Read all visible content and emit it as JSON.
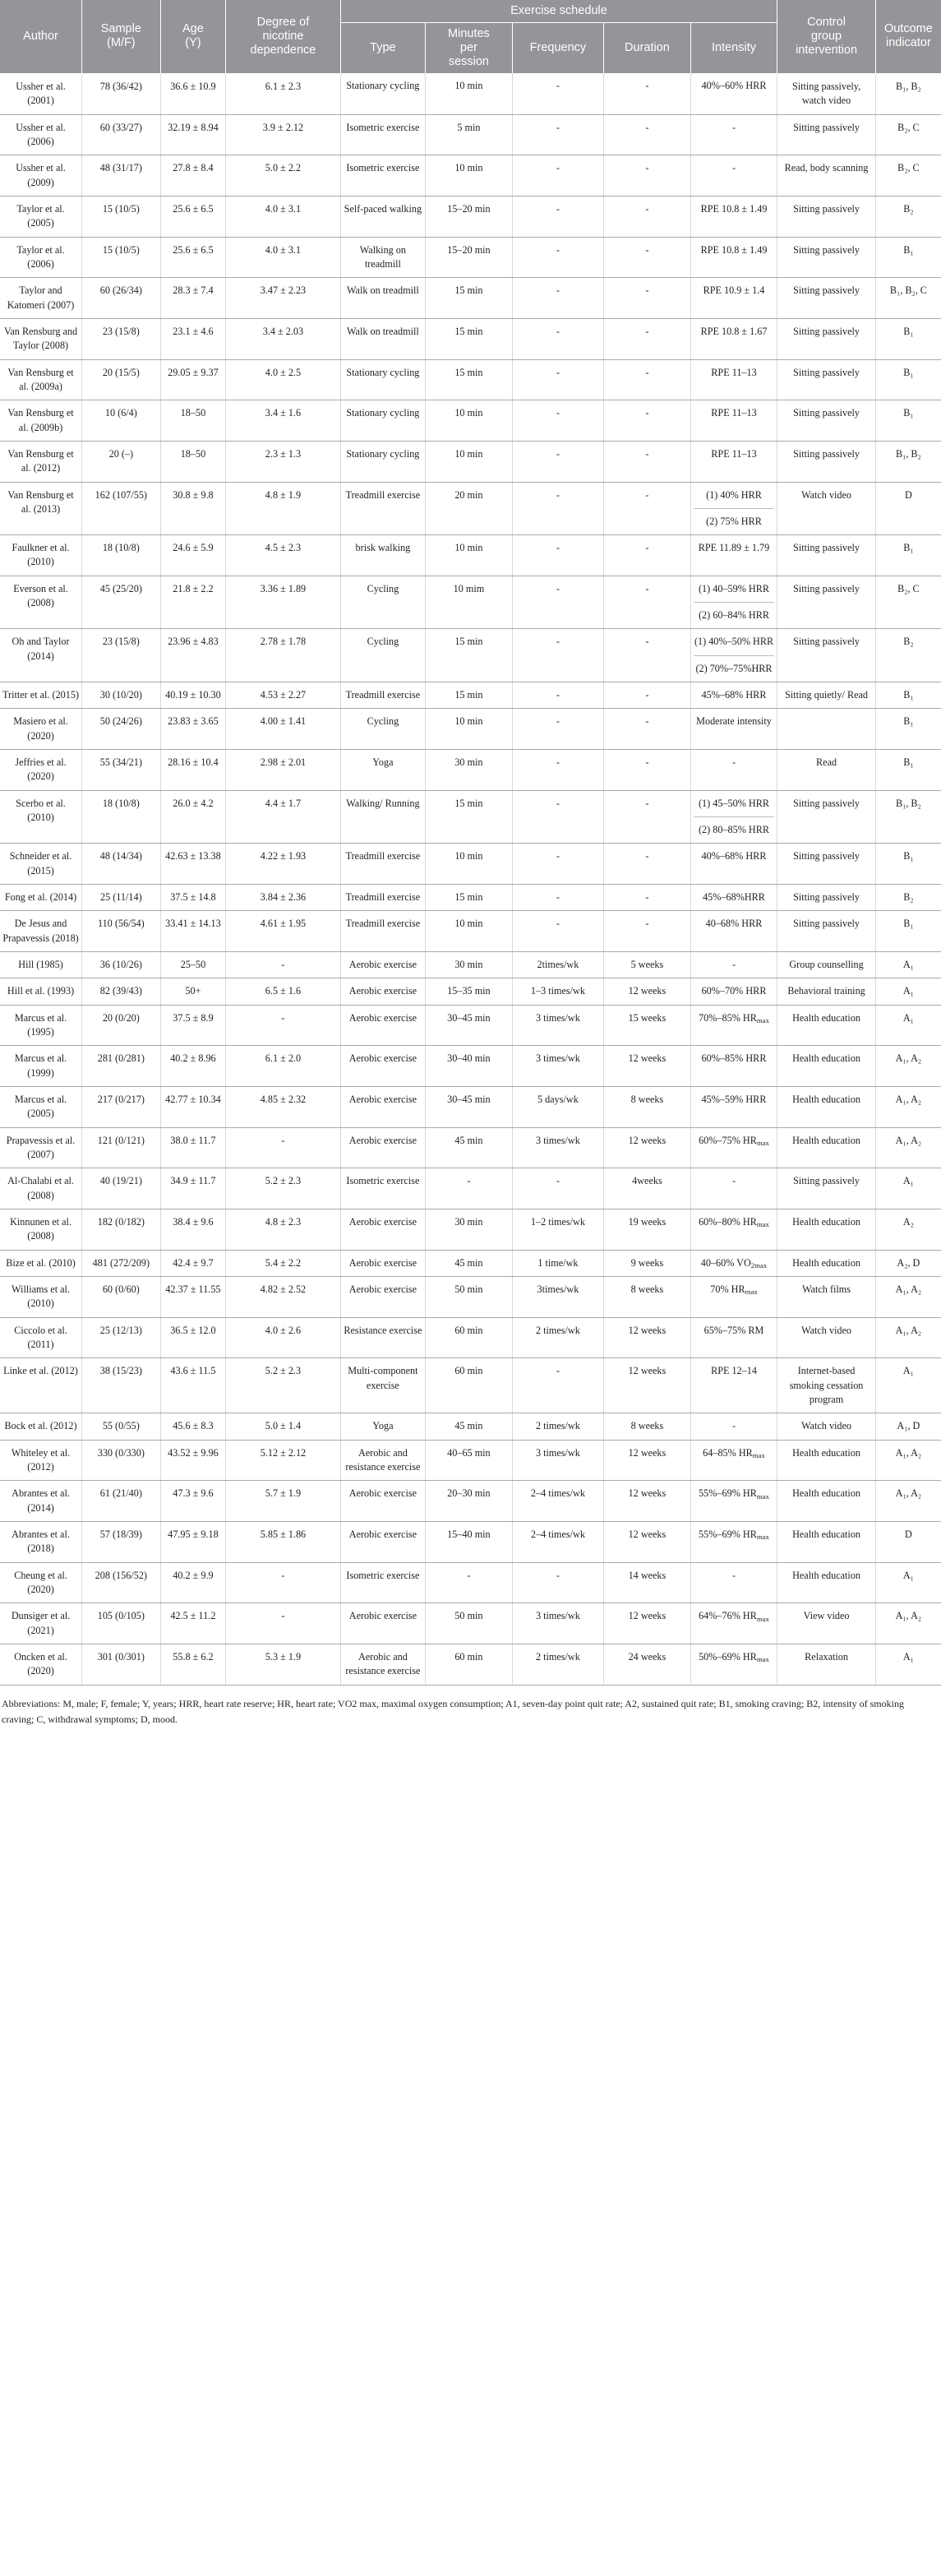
{
  "table": {
    "header": {
      "group_exercise_schedule": "Exercise schedule",
      "columns": [
        "Author",
        "Sample (M/F)",
        "Age (Y)",
        "Degree of nicotine dependence",
        "Type",
        "Minutes per session",
        "Frequency",
        "Duration",
        "Intensity",
        "Control group intervention",
        "Outcome indicator"
      ],
      "author": "Author",
      "sample": "Sample\n(M/F)",
      "sample_l1": "Sample",
      "sample_l2": "(M/F)",
      "age_l1": "Age",
      "age_l2": "(Y)",
      "nicotine_l1": "Degree of",
      "nicotine_l2": "nicotine",
      "nicotine_l3": "dependence",
      "type": "Type",
      "minutes_l1": "Minutes",
      "minutes_l2": "per",
      "minutes_l3": "session",
      "frequency": "Frequency",
      "duration": "Duration",
      "intensity": "Intensity",
      "control_l1": "Control",
      "control_l2": "group",
      "control_l3": "intervention",
      "outcome_l1": "Outcome",
      "outcome_l2": "indicator"
    },
    "rows": [
      {
        "author": "Ussher et al. (2001)",
        "sample": "78 (36/42)",
        "age": "36.6 ± 10.9",
        "nicotine": "6.1 ± 2.3",
        "type": "Stationary cycling",
        "minutes": "10 min",
        "frequency": "-",
        "duration": "-",
        "intensity": "40%–60% HRR",
        "control": "Sitting passively, watch video",
        "outcome": "B₁, B₂"
      },
      {
        "author": "Ussher et al. (2006)",
        "sample": "60 (33/27)",
        "age": "32.19 ± 8.94",
        "nicotine": "3.9 ± 2.12",
        "type": "Isometric exercise",
        "minutes": "5 min",
        "frequency": "-",
        "duration": "-",
        "intensity": "-",
        "control": "Sitting passively",
        "outcome": "B₂, C"
      },
      {
        "author": "Ussher et al. (2009)",
        "sample": "48 (31/17)",
        "age": "27.8 ± 8.4",
        "nicotine": "5.0 ± 2.2",
        "type": "Isometric exercise",
        "minutes": "10 min",
        "frequency": "-",
        "duration": "-",
        "intensity": "-",
        "control": "Read, body scanning",
        "outcome": "B₂, C"
      },
      {
        "author": "Taylor et al. (2005)",
        "sample": "15 (10/5)",
        "age": "25.6 ± 6.5",
        "nicotine": "4.0 ± 3.1",
        "type": "Self-paced walking",
        "minutes": "15–20 min",
        "frequency": "-",
        "duration": "-",
        "intensity": "RPE 10.8 ± 1.49",
        "control": "Sitting passively",
        "outcome": "B₂"
      },
      {
        "author": "Taylor et al. (2006)",
        "sample": "15 (10/5)",
        "age": "25.6 ± 6.5",
        "nicotine": "4.0 ± 3.1",
        "type": "Walking on treadmill",
        "minutes": "15–20 min",
        "frequency": "-",
        "duration": "-",
        "intensity": "RPE 10.8 ± 1.49",
        "control": "Sitting passively",
        "outcome": "B₁"
      },
      {
        "author": "Taylor and Katomeri (2007)",
        "sample": "60 (26/34)",
        "age": "28.3 ± 7.4",
        "nicotine": "3.47 ± 2.23",
        "type": "Walk on treadmill",
        "minutes": "15 min",
        "frequency": "-",
        "duration": "-",
        "intensity": "RPE 10.9 ± 1.4",
        "control": "Sitting passively",
        "outcome": "B₁, B₂, C"
      },
      {
        "author": "Van Rensburg and Taylor (2008)",
        "sample": "23 (15/8)",
        "age": "23.1 ± 4.6",
        "nicotine": "3.4 ± 2.03",
        "type": "Walk on treadmill",
        "minutes": "15 min",
        "frequency": "-",
        "duration": "-",
        "intensity": "RPE 10.8 ± 1.67",
        "control": "Sitting passively",
        "outcome": "B₁"
      },
      {
        "author": "Van Rensburg et al. (2009a)",
        "sample": "20 (15/5)",
        "age": "29.05 ± 9.37",
        "nicotine": "4.0 ± 2.5",
        "type": "Stationary cycling",
        "minutes": "15 min",
        "frequency": "-",
        "duration": "-",
        "intensity": "RPE 11–13",
        "control": "Sitting passively",
        "outcome": "B₁"
      },
      {
        "author": "Van Rensburg et al. (2009b)",
        "sample": "10 (6/4)",
        "age": "18–50",
        "nicotine": "3.4 ± 1.6",
        "type": "Stationary cycling",
        "minutes": "10 min",
        "frequency": "-",
        "duration": "-",
        "intensity": "RPE 11–13",
        "control": "Sitting passively",
        "outcome": "B₁"
      },
      {
        "author": "Van Rensburg et al. (2012)",
        "sample": "20 (–)",
        "age": "18–50",
        "nicotine": "2.3 ± 1.3",
        "type": "Stationary cycling",
        "minutes": "10 min",
        "frequency": "-",
        "duration": "-",
        "intensity": "RPE 11–13",
        "control": "Sitting passively",
        "outcome": "B₁, B₂"
      },
      {
        "author": "Van Rensburg et al. (2013)",
        "sample": "162 (107/55)",
        "age": "30.8 ± 9.8",
        "nicotine": "4.8 ± 1.9",
        "type": "Treadmill exercise",
        "minutes": "20 min",
        "frequency": "-",
        "duration": "-",
        "intensity_parts": [
          "(1) 40% HRR",
          "(2) 75% HRR"
        ],
        "control": "Watch video",
        "outcome": "D"
      },
      {
        "author": "Faulkner et al. (2010)",
        "sample": "18 (10/8)",
        "age": "24.6 ± 5.9",
        "nicotine": "4.5 ± 2.3",
        "type": "brisk walking",
        "minutes": "10 min",
        "frequency": "-",
        "duration": "-",
        "intensity": "RPE 11.89 ± 1.79",
        "control": "Sitting passively",
        "outcome": "B₁"
      },
      {
        "author": "Everson et al. (2008)",
        "sample": "45 (25/20)",
        "age": "21.8 ± 2.2",
        "nicotine": "3.36 ± 1.89",
        "type": "Cycling",
        "minutes": "10 mim",
        "frequency": "-",
        "duration": "-",
        "intensity_parts": [
          "(1) 40–59% HRR",
          "(2) 60–84% HRR"
        ],
        "control": "Sitting passively",
        "outcome": "B₂, C"
      },
      {
        "author": "Oh and Taylor (2014)",
        "sample": "23 (15/8)",
        "age": "23.96 ± 4.83",
        "nicotine": "2.78 ± 1.78",
        "type": "Cycling",
        "minutes": "15 min",
        "frequency": "-",
        "duration": "-",
        "intensity_parts": [
          "(1) 40%–50% HRR",
          "(2) 70%–75%HRR"
        ],
        "control": "Sitting passively",
        "outcome": "B₂"
      },
      {
        "author": "Tritter et al. (2015)",
        "sample": "30 (10/20)",
        "age": "40.19 ± 10.30",
        "nicotine": "4.53 ± 2.27",
        "type": "Treadmill exercise",
        "minutes": "15 min",
        "frequency": "-",
        "duration": "-",
        "intensity": "45%–68% HRR",
        "control": "Sitting quietly/ Read",
        "outcome": "B₁"
      },
      {
        "author": "Masiero et al. (2020)",
        "sample": "50 (24/26)",
        "age": "23.83 ± 3.65",
        "nicotine": "4.00 ± 1.41",
        "type": "Cycling",
        "minutes": "10 min",
        "frequency": "-",
        "duration": "-",
        "intensity": "Moderate intensity",
        "control": "",
        "outcome": "B₁"
      },
      {
        "author": "Jeffries et al. (2020)",
        "sample": "55 (34/21)",
        "age": "28.16 ± 10.4",
        "nicotine": "2.98 ± 2.01",
        "type": "Yoga",
        "minutes": "30 min",
        "frequency": "-",
        "duration": "-",
        "intensity": "-",
        "control": "Read",
        "outcome": "B₁"
      },
      {
        "author": "Scerbo et al. (2010)",
        "sample": "18 (10/8)",
        "age": "26.0 ± 4.2",
        "nicotine": "4.4 ± 1.7",
        "type": "Walking/ Running",
        "minutes": "15 min",
        "frequency": "-",
        "duration": "-",
        "intensity_parts": [
          "(1) 45–50% HRR",
          "(2) 80–85% HRR"
        ],
        "control": "Sitting passively",
        "outcome": "B₁, B₂"
      },
      {
        "author": "Schneider et al. (2015)",
        "sample": "48 (14/34)",
        "age": "42.63 ± 13.38",
        "nicotine": "4.22 ± 1.93",
        "type": "Treadmill exercise",
        "minutes": "10 min",
        "frequency": "-",
        "duration": "-",
        "intensity": "40%–68% HRR",
        "control": "Sitting passively",
        "outcome": "B₁"
      },
      {
        "author": "Fong et al. (2014)",
        "sample": "25 (11/14)",
        "age": "37.5 ± 14.8",
        "nicotine": "3.84 ± 2.36",
        "type": "Treadmill exercise",
        "minutes": "15 min",
        "frequency": "-",
        "duration": "-",
        "intensity": "45%–68%HRR",
        "control": "Sitting passively",
        "outcome": "B₂"
      },
      {
        "author": "De Jesus and Prapavessis (2018)",
        "sample": "110 (56/54)",
        "age": "33.41 ± 14.13",
        "nicotine": "4.61 ± 1.95",
        "type": "Treadmill exercise",
        "minutes": "10 min",
        "frequency": "-",
        "duration": "-",
        "intensity": "40–68% HRR",
        "control": "Sitting passively",
        "outcome": "B₁"
      },
      {
        "author": "Hill (1985)",
        "sample": "36 (10/26)",
        "age": "25–50",
        "nicotine": "-",
        "type": "Aerobic exercise",
        "minutes": "30 min",
        "frequency": "2times/wk",
        "duration": "5 weeks",
        "intensity": "-",
        "control": "Group counselling",
        "outcome": "A₁"
      },
      {
        "author": "Hill et al. (1993)",
        "sample": "82 (39/43)",
        "age": "50+",
        "nicotine": "6.5 ± 1.6",
        "type": "Aerobic exercise",
        "minutes": "15–35 min",
        "frequency": "1–3 times/wk",
        "duration": "12 weeks",
        "intensity": "60%–70% HRR",
        "control": "Behavioral training",
        "outcome": "A₁"
      },
      {
        "author": "Marcus et al. (1995)",
        "sample": "20 (0/20)",
        "age": "37.5 ± 8.9",
        "nicotine": "-",
        "type": "Aerobic exercise",
        "minutes": "30–45 min",
        "frequency": "3 times/wk",
        "duration": "15 weeks",
        "intensity": "70%–85% HR<sub>max</sub>",
        "control": "Health education",
        "outcome": "A₁"
      },
      {
        "author": "Marcus et al. (1999)",
        "sample": "281 (0/281)",
        "age": "40.2 ± 8.96",
        "nicotine": "6.1 ± 2.0",
        "type": "Aerobic exercise",
        "minutes": "30–40 min",
        "frequency": "3 times/wk",
        "duration": "12 weeks",
        "intensity": "60%–85% HRR",
        "control": "Health education",
        "outcome": "A₁, A₂"
      },
      {
        "author": "Marcus et al. (2005)",
        "sample": "217 (0/217)",
        "age": "42.77 ± 10.34",
        "nicotine": "4.85 ± 2.32",
        "type": "Aerobic exercise",
        "minutes": "30–45 min",
        "frequency": "5 days/wk",
        "duration": "8 weeks",
        "intensity": "45%–59% HRR",
        "control": "Health education",
        "outcome": "A₁, A₂"
      },
      {
        "author": "Prapavessis et al. (2007)",
        "sample": "121 (0/121)",
        "age": "38.0 ± 11.7",
        "nicotine": "-",
        "type": "Aerobic exercise",
        "minutes": "45 min",
        "frequency": "3 times/wk",
        "duration": "12 weeks",
        "intensity": "60%–75% HR<sub>max</sub>",
        "control": "Health education",
        "outcome": "A₁, A₂"
      },
      {
        "author": "Al-Chalabi et al. (2008)",
        "sample": "40 (19/21)",
        "age": "34.9 ± 11.7",
        "nicotine": "5.2 ± 2.3",
        "type": "Isometric exercise",
        "minutes": "-",
        "frequency": "-",
        "duration": "4weeks",
        "intensity": "-",
        "control": "Sitting passively",
        "outcome": "A₁"
      },
      {
        "author": "Kinnunen et al. (2008)",
        "sample": "182 (0/182)",
        "age": "38.4 ± 9.6",
        "nicotine": "4.8 ± 2.3",
        "type": "Aerobic exercise",
        "minutes": "30 min",
        "frequency": "1–2 times/wk",
        "duration": "19 weeks",
        "intensity": "60%–80% HR<sub>max</sub>",
        "control": "Health education",
        "outcome": "A₂"
      },
      {
        "author": "Bize et al. (2010)",
        "sample": "481 (272/209)",
        "age": "42.4 ± 9.7",
        "nicotine": "5.4 ± 2.2",
        "type": "Aerobic exercise",
        "minutes": "45 min",
        "frequency": "1 time/wk",
        "duration": "9 weeks",
        "intensity": "40–60% VO<sub>2max</sub>",
        "control": "Health education",
        "outcome": "A₂, D"
      },
      {
        "author": "Williams et al. (2010)",
        "sample": "60 (0/60)",
        "age": "42.37 ± 11.55",
        "nicotine": "4.82 ± 2.52",
        "type": "Aerobic exercise",
        "minutes": "50 min",
        "frequency": "3times/wk",
        "duration": "8 weeks",
        "intensity": "70% HR<sub>max</sub>",
        "control": "Watch films",
        "outcome": "A₁, A₂"
      },
      {
        "author": "Ciccolo et al. (2011)",
        "sample": "25 (12/13)",
        "age": "36.5 ± 12.0",
        "nicotine": "4.0 ± 2.6",
        "type": "Resistance exercise",
        "minutes": "60 min",
        "frequency": "2 times/wk",
        "duration": "12 weeks",
        "intensity": "65%–75% RM",
        "control": "Watch video",
        "outcome": "A₁, A₂"
      },
      {
        "author": "Linke et al. (2012)",
        "sample": "38 (15/23)",
        "age": "43.6 ± 11.5",
        "nicotine": "5.2 ± 2.3",
        "type": "Multi-component exercise",
        "minutes": "60 min",
        "frequency": "-",
        "duration": "12 weeks",
        "intensity": "RPE 12–14",
        "control": "Internet-based smoking cessation program",
        "outcome": "A₁"
      },
      {
        "author": "Bock et al. (2012)",
        "sample": "55 (0/55)",
        "age": "45.6 ± 8.3",
        "nicotine": "5.0 ± 1.4",
        "type": "Yoga",
        "minutes": "45 min",
        "frequency": "2 times/wk",
        "duration": "8 weeks",
        "intensity": "-",
        "control": "Watch video",
        "outcome": "A₁, D"
      },
      {
        "author": "Whiteley et al. (2012)",
        "sample": "330 (0/330)",
        "age": "43.52 ± 9.96",
        "nicotine": "5.12 ± 2.12",
        "type": "Aerobic and resistance exercise",
        "minutes": "40–65 min",
        "frequency": "3 times/wk",
        "duration": "12 weeks",
        "intensity": "64–85% HR<sub>max</sub>",
        "control": "Health education",
        "outcome": "A₁, A₂"
      },
      {
        "author": "Abrantes et al. (2014)",
        "sample": "61 (21/40)",
        "age": "47.3 ± 9.6",
        "nicotine": "5.7 ± 1.9",
        "type": "Aerobic exercise",
        "minutes": "20–30 min",
        "frequency": "2–4 times/wk",
        "duration": "12 weeks",
        "intensity": "55%–69% HR<sub>max</sub>",
        "control": "Health education",
        "outcome": "A₁, A₂"
      },
      {
        "author": "Abrantes et al. (2018)",
        "sample": "57 (18/39)",
        "age": "47.95 ± 9.18",
        "nicotine": "5.85 ± 1.86",
        "type": "Aerobic exercise",
        "minutes": "15–40 min",
        "frequency": "2–4 times/wk",
        "duration": "12 weeks",
        "intensity": "55%–69% HR<sub>max</sub>",
        "control": "Health education",
        "outcome": "D"
      },
      {
        "author": "Cheung et al. (2020)",
        "sample": "208 (156/52)",
        "age": "40.2 ± 9.9",
        "nicotine": "-",
        "type": "Isometric exercise",
        "minutes": "-",
        "frequency": "-",
        "duration": "14 weeks",
        "intensity": "-",
        "control": "Health education",
        "outcome": "A₁"
      },
      {
        "author": "Dunsiger et al. (2021)",
        "sample": "105 (0/105)",
        "age": "42.5 ± 11.2",
        "nicotine": "-",
        "type": "Aerobic exercise",
        "minutes": "50 min",
        "frequency": "3 times/wk",
        "duration": "12 weeks",
        "intensity": "64%–76% HR<sub>max</sub>",
        "control": "View video",
        "outcome": "A₁, A₂"
      },
      {
        "author": "Oncken et al. (2020)",
        "sample": "301 (0/301)",
        "age": "55.8 ± 6.2",
        "nicotine": "5.3 ± 1.9",
        "type": "Aerobic and resistance exercise",
        "minutes": "60 min",
        "frequency": "2 times/wk",
        "duration": "24 weeks",
        "intensity": "50%–69% HR<sub>max</sub>",
        "control": "Relaxation",
        "outcome": "A₁"
      }
    ],
    "footnote": "Abbreviations: M, male; F, female; Y, years; HRR, heart rate reserve; HR, heart rate; VO2 max, maximal oxygen consumption; A1, seven-day point quit rate; A2, sustained quit rate; B1, smoking craving; B2, intensity of smoking craving; C, withdrawal symptoms; D, mood."
  },
  "colors": {
    "header_bg": "#939598",
    "header_text": "#ffffff",
    "body_text": "#231f20",
    "row_border": "#a7a9ac",
    "cell_border": "#d9d9d9"
  }
}
